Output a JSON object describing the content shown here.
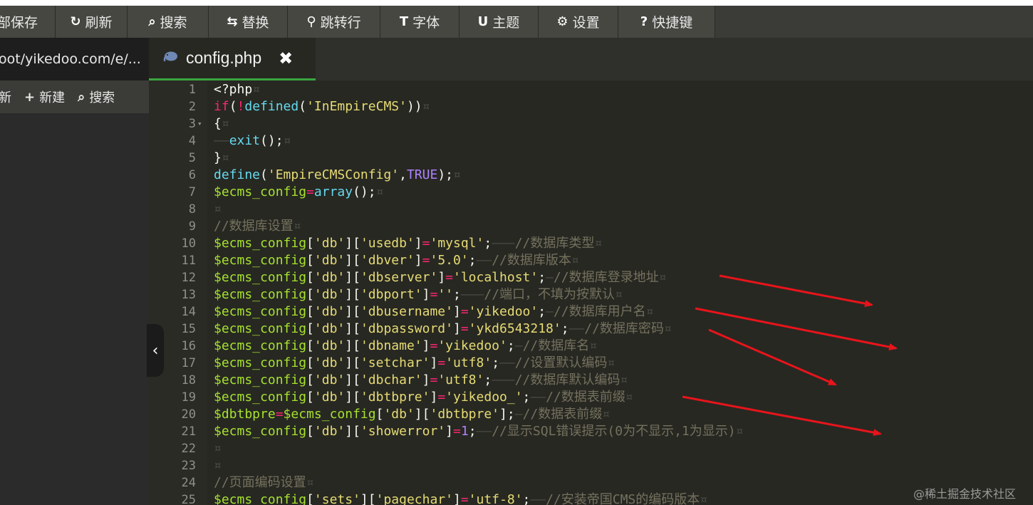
{
  "toolbar": {
    "items": [
      {
        "label": "部保存",
        "icon": "",
        "icon_name": "save-icon",
        "width": 82
      },
      {
        "label": "刷新",
        "icon": "↻",
        "icon_name": "refresh-icon",
        "width": 101
      },
      {
        "label": "搜索",
        "icon": "⌕",
        "icon_name": "search-icon",
        "width": 114
      },
      {
        "label": "替换",
        "icon": "⇆",
        "icon_name": "replace-icon",
        "width": 111
      },
      {
        "label": "跳转行",
        "icon": "⚲",
        "icon_name": "pin-icon",
        "width": 130
      },
      {
        "label": "字体",
        "icon": "T",
        "icon_name": "font-icon",
        "width": 111
      },
      {
        "label": "主题",
        "icon": "U",
        "icon_name": "theme-icon",
        "width": 111
      },
      {
        "label": "设置",
        "icon": "⚙",
        "icon_name": "gear-icon",
        "width": 112
      },
      {
        "label": "快捷键",
        "icon": "?",
        "icon_name": "question-icon",
        "width": 136
      }
    ]
  },
  "sidebar": {
    "path": "oot/yikedoo.com/e/...",
    "actions": [
      {
        "label": "新",
        "icon": "",
        "icon_name": "refresh-icon"
      },
      {
        "label": "新建",
        "icon": "+",
        "icon_name": "plus-icon"
      },
      {
        "label": "搜索",
        "icon": "⌕",
        "icon_name": "search-icon"
      }
    ],
    "collapse_icon": "‹"
  },
  "tab": {
    "filename": "config.php",
    "file_icon": "php-elephant-icon",
    "close_glyph": "✖"
  },
  "editor": {
    "lines": [
      {
        "n": "1",
        "tokens": [
          [
            "plain",
            "<?php"
          ],
          [
            "ws",
            "¤"
          ]
        ]
      },
      {
        "n": "2",
        "tokens": [
          [
            "kw",
            "if"
          ],
          [
            "plain",
            "("
          ],
          [
            "kw",
            "!"
          ],
          [
            "fn",
            "defined"
          ],
          [
            "plain",
            "("
          ],
          [
            "str",
            "'InEmpireCMS'"
          ],
          [
            "plain",
            "))"
          ],
          [
            "ws",
            "¤"
          ]
        ]
      },
      {
        "n": "3",
        "fold": true,
        "tokens": [
          [
            "plain",
            "{"
          ],
          [
            "ws",
            "¤"
          ]
        ]
      },
      {
        "n": "4",
        "tokens": [
          [
            "ws",
            "——"
          ],
          [
            "fn",
            "exit"
          ],
          [
            "plain",
            "();"
          ],
          [
            "ws",
            "¤"
          ]
        ]
      },
      {
        "n": "5",
        "tokens": [
          [
            "plain",
            "}"
          ],
          [
            "ws",
            "¤"
          ]
        ]
      },
      {
        "n": "6",
        "tokens": [
          [
            "fn",
            "define"
          ],
          [
            "plain",
            "("
          ],
          [
            "str",
            "'EmpireCMSConfig'"
          ],
          [
            "plain",
            ","
          ],
          [
            "const",
            "TRUE"
          ],
          [
            "plain",
            ");"
          ],
          [
            "ws",
            "¤"
          ]
        ]
      },
      {
        "n": "7",
        "tokens": [
          [
            "var",
            "$ecms_config"
          ],
          [
            "kw",
            "="
          ],
          [
            "fn",
            "array"
          ],
          [
            "plain",
            "();"
          ],
          [
            "ws",
            "¤"
          ]
        ]
      },
      {
        "n": "8",
        "tokens": [
          [
            "ws",
            "¤"
          ]
        ]
      },
      {
        "n": "9",
        "tokens": [
          [
            "com",
            "//数据库设置"
          ],
          [
            "ws",
            "¤"
          ]
        ]
      },
      {
        "n": "10",
        "tokens": [
          [
            "var",
            "$ecms_config"
          ],
          [
            "plain",
            "["
          ],
          [
            "str",
            "'db'"
          ],
          [
            "plain",
            "]["
          ],
          [
            "str",
            "'usedb'"
          ],
          [
            "plain",
            "]"
          ],
          [
            "kw",
            "="
          ],
          [
            "str",
            "'mysql'"
          ],
          [
            "plain",
            ";"
          ],
          [
            "ws",
            "———"
          ],
          [
            "com",
            "//数据库类型"
          ],
          [
            "ws",
            "¤"
          ]
        ]
      },
      {
        "n": "11",
        "tokens": [
          [
            "var",
            "$ecms_config"
          ],
          [
            "plain",
            "["
          ],
          [
            "str",
            "'db'"
          ],
          [
            "plain",
            "]["
          ],
          [
            "str",
            "'dbver'"
          ],
          [
            "plain",
            "]"
          ],
          [
            "kw",
            "="
          ],
          [
            "str",
            "'5.0'"
          ],
          [
            "plain",
            ";"
          ],
          [
            "ws",
            "——"
          ],
          [
            "com",
            "//数据库版本"
          ],
          [
            "ws",
            "¤"
          ]
        ]
      },
      {
        "n": "12",
        "tokens": [
          [
            "var",
            "$ecms_config"
          ],
          [
            "plain",
            "["
          ],
          [
            "str",
            "'db'"
          ],
          [
            "plain",
            "]["
          ],
          [
            "str",
            "'dbserver'"
          ],
          [
            "plain",
            "]"
          ],
          [
            "kw",
            "="
          ],
          [
            "str",
            "'localhost'"
          ],
          [
            "plain",
            ";"
          ],
          [
            "ws",
            "—"
          ],
          [
            "com",
            "//数据库登录地址"
          ],
          [
            "ws",
            "¤"
          ]
        ]
      },
      {
        "n": "13",
        "tokens": [
          [
            "var",
            "$ecms_config"
          ],
          [
            "plain",
            "["
          ],
          [
            "str",
            "'db'"
          ],
          [
            "plain",
            "]["
          ],
          [
            "str",
            "'dbport'"
          ],
          [
            "plain",
            "]"
          ],
          [
            "kw",
            "="
          ],
          [
            "str",
            "''"
          ],
          [
            "plain",
            ";"
          ],
          [
            "ws",
            "———"
          ],
          [
            "com",
            "//端口，不填为按默认"
          ],
          [
            "ws",
            "¤"
          ]
        ]
      },
      {
        "n": "14",
        "tokens": [
          [
            "var",
            "$ecms_config"
          ],
          [
            "plain",
            "["
          ],
          [
            "str",
            "'db'"
          ],
          [
            "plain",
            "]["
          ],
          [
            "str",
            "'dbusername'"
          ],
          [
            "plain",
            "]"
          ],
          [
            "kw",
            "="
          ],
          [
            "str",
            "'yikedoo'"
          ],
          [
            "plain",
            ";"
          ],
          [
            "ws",
            "—"
          ],
          [
            "com",
            "//数据库用户名"
          ],
          [
            "ws",
            "¤"
          ]
        ]
      },
      {
        "n": "15",
        "tokens": [
          [
            "var",
            "$ecms_config"
          ],
          [
            "plain",
            "["
          ],
          [
            "str",
            "'db'"
          ],
          [
            "plain",
            "]["
          ],
          [
            "str",
            "'dbpassword'"
          ],
          [
            "plain",
            "]"
          ],
          [
            "kw",
            "="
          ],
          [
            "str",
            "'ykd6543218'"
          ],
          [
            "plain",
            ";"
          ],
          [
            "ws",
            "——"
          ],
          [
            "com",
            "//数据库密码"
          ],
          [
            "ws",
            "¤"
          ]
        ]
      },
      {
        "n": "16",
        "tokens": [
          [
            "var",
            "$ecms_config"
          ],
          [
            "plain",
            "["
          ],
          [
            "str",
            "'db'"
          ],
          [
            "plain",
            "]["
          ],
          [
            "str",
            "'dbname'"
          ],
          [
            "plain",
            "]"
          ],
          [
            "kw",
            "="
          ],
          [
            "str",
            "'yikedoo'"
          ],
          [
            "plain",
            ";"
          ],
          [
            "ws",
            "—"
          ],
          [
            "com",
            "//数据库名"
          ],
          [
            "ws",
            "¤"
          ]
        ]
      },
      {
        "n": "17",
        "tokens": [
          [
            "var",
            "$ecms_config"
          ],
          [
            "plain",
            "["
          ],
          [
            "str",
            "'db'"
          ],
          [
            "plain",
            "]["
          ],
          [
            "str",
            "'setchar'"
          ],
          [
            "plain",
            "]"
          ],
          [
            "kw",
            "="
          ],
          [
            "str",
            "'utf8'"
          ],
          [
            "plain",
            ";"
          ],
          [
            "ws",
            "——"
          ],
          [
            "com",
            "//设置默认编码"
          ],
          [
            "ws",
            "¤"
          ]
        ]
      },
      {
        "n": "18",
        "tokens": [
          [
            "var",
            "$ecms_config"
          ],
          [
            "plain",
            "["
          ],
          [
            "str",
            "'db'"
          ],
          [
            "plain",
            "]["
          ],
          [
            "str",
            "'dbchar'"
          ],
          [
            "plain",
            "]"
          ],
          [
            "kw",
            "="
          ],
          [
            "str",
            "'utf8'"
          ],
          [
            "plain",
            ";"
          ],
          [
            "ws",
            "———"
          ],
          [
            "com",
            "//数据库默认编码"
          ],
          [
            "ws",
            "¤"
          ]
        ]
      },
      {
        "n": "19",
        "tokens": [
          [
            "var",
            "$ecms_config"
          ],
          [
            "plain",
            "["
          ],
          [
            "str",
            "'db'"
          ],
          [
            "plain",
            "]["
          ],
          [
            "str",
            "'dbtbpre'"
          ],
          [
            "plain",
            "]"
          ],
          [
            "kw",
            "="
          ],
          [
            "str",
            "'yikedoo_'"
          ],
          [
            "plain",
            ";"
          ],
          [
            "ws",
            "——"
          ],
          [
            "com",
            "//数据表前缀"
          ],
          [
            "ws",
            "¤"
          ]
        ]
      },
      {
        "n": "20",
        "tokens": [
          [
            "var",
            "$dbtbpre"
          ],
          [
            "kw",
            "="
          ],
          [
            "var",
            "$ecms_config"
          ],
          [
            "plain",
            "["
          ],
          [
            "str",
            "'db'"
          ],
          [
            "plain",
            "]["
          ],
          [
            "str",
            "'dbtbpre'"
          ],
          [
            "plain",
            "];"
          ],
          [
            "ws",
            "—"
          ],
          [
            "com",
            "//数据表前缀"
          ],
          [
            "ws",
            "¤"
          ]
        ]
      },
      {
        "n": "21",
        "tokens": [
          [
            "var",
            "$ecms_config"
          ],
          [
            "plain",
            "["
          ],
          [
            "str",
            "'db'"
          ],
          [
            "plain",
            "]["
          ],
          [
            "str",
            "'showerror'"
          ],
          [
            "plain",
            "]"
          ],
          [
            "kw",
            "="
          ],
          [
            "num",
            "1"
          ],
          [
            "plain",
            ";"
          ],
          [
            "ws",
            "——"
          ],
          [
            "com",
            "//显示SQL错误提示(0为不显示,1为显示)"
          ],
          [
            "ws",
            "¤"
          ]
        ]
      },
      {
        "n": "22",
        "tokens": [
          [
            "ws",
            "¤"
          ]
        ]
      },
      {
        "n": "23",
        "tokens": [
          [
            "ws",
            "¤"
          ]
        ]
      },
      {
        "n": "24",
        "tokens": [
          [
            "com",
            "//页面编码设置"
          ],
          [
            "ws",
            "¤"
          ]
        ]
      },
      {
        "n": "25",
        "tokens": [
          [
            "var",
            "$ecms_config"
          ],
          [
            "plain",
            "["
          ],
          [
            "str",
            "'sets'"
          ],
          [
            "plain",
            "]["
          ],
          [
            "str",
            "'pagechar'"
          ],
          [
            "plain",
            "]"
          ],
          [
            "kw",
            "="
          ],
          [
            "str",
            "'utf-8'"
          ],
          [
            "plain",
            ";"
          ],
          [
            "ws",
            "——"
          ],
          [
            "com",
            "//安装帝国CMS的编码版本"
          ],
          [
            "ws",
            "¤"
          ]
        ]
      }
    ]
  },
  "annotation": {
    "arrow_color": "#e8141b",
    "arrow_count": 4
  },
  "watermark": "@稀土掘金技术社区",
  "colors": {
    "editor_bg": "#272822",
    "toolbar_bg": "#3b3c37",
    "tab_accent": "#3aa640",
    "keyword": "#f92672",
    "function": "#66d9ef",
    "variable": "#a6e22e",
    "string": "#e6db74",
    "number": "#ae81ff",
    "comment": "#75715e"
  }
}
